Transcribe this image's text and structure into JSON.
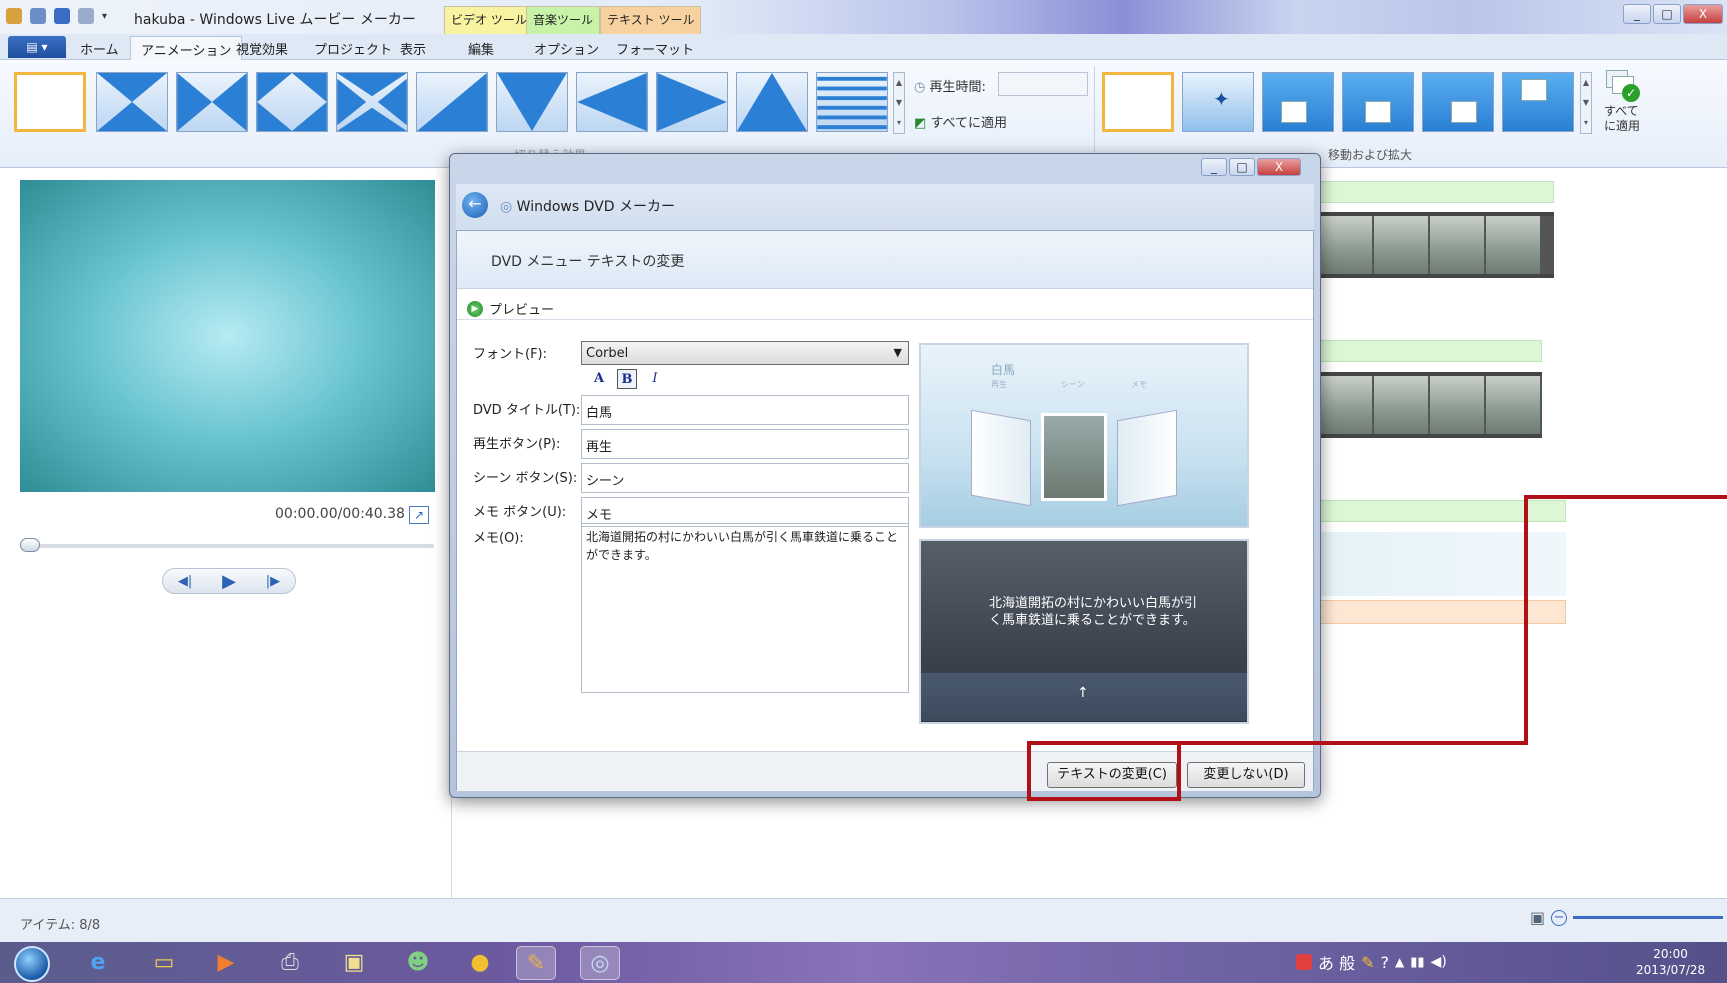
{
  "window": {
    "title": "hakuba - Windows Live ムービー メーカー",
    "context_tabs": [
      "ビデオ ツール",
      "音楽ツール",
      "テキスト ツール"
    ],
    "controls": {
      "minimize": "_",
      "maximize": "□",
      "close": "X"
    }
  },
  "tabs": [
    "ホーム",
    "アニメーション",
    "視覚効果",
    "プロジェクト",
    "表示",
    "編集",
    "オプション",
    "フォーマット"
  ],
  "active_tab": "アニメーション",
  "ribbon": {
    "duration_label": "再生時間:",
    "apply_all_label": "すべてに適用",
    "transitions_group": "切り替え効果",
    "panzoom_group": "移動および拡大",
    "apply_all_big_label": "すべて\nに適用"
  },
  "preview": {
    "timecode": "00:00.00/00:40.38"
  },
  "status": {
    "items": "アイテム: 8/8"
  },
  "taskbar": {
    "clock_time": "20:00",
    "clock_date": "2013/07/28",
    "ime": "あ 般"
  },
  "dialog": {
    "app_name": "Windows DVD メーカー",
    "headline": "DVD メニュー テキストの変更",
    "preview_link": "プレビュー",
    "font_label": "フォント(F):",
    "font_value": "Corbel",
    "title_label": "DVD タイトル(T):",
    "title_value": "白馬",
    "play_label": "再生ボタン(P):",
    "play_value": "再生",
    "scene_label": "シーン ボタン(S):",
    "scene_value": "シーン",
    "memo_btn_label": "メモ ボタン(U):",
    "memo_btn_value": "メモ",
    "memo_label": "メモ(O):",
    "memo_value": "北海道開拓の村にかわいい白馬が引く馬車鉄道に乗ることができます。",
    "preview1_title": "白馬",
    "preview1_menu": [
      "再生",
      "シーン",
      "メモ"
    ],
    "preview2_text": "北海道開拓の村にかわいい白馬が引く馬車鉄道に乗ることができます。",
    "change_button": "テキストの変更(C)",
    "cancel_button": "変更しない(D)"
  }
}
